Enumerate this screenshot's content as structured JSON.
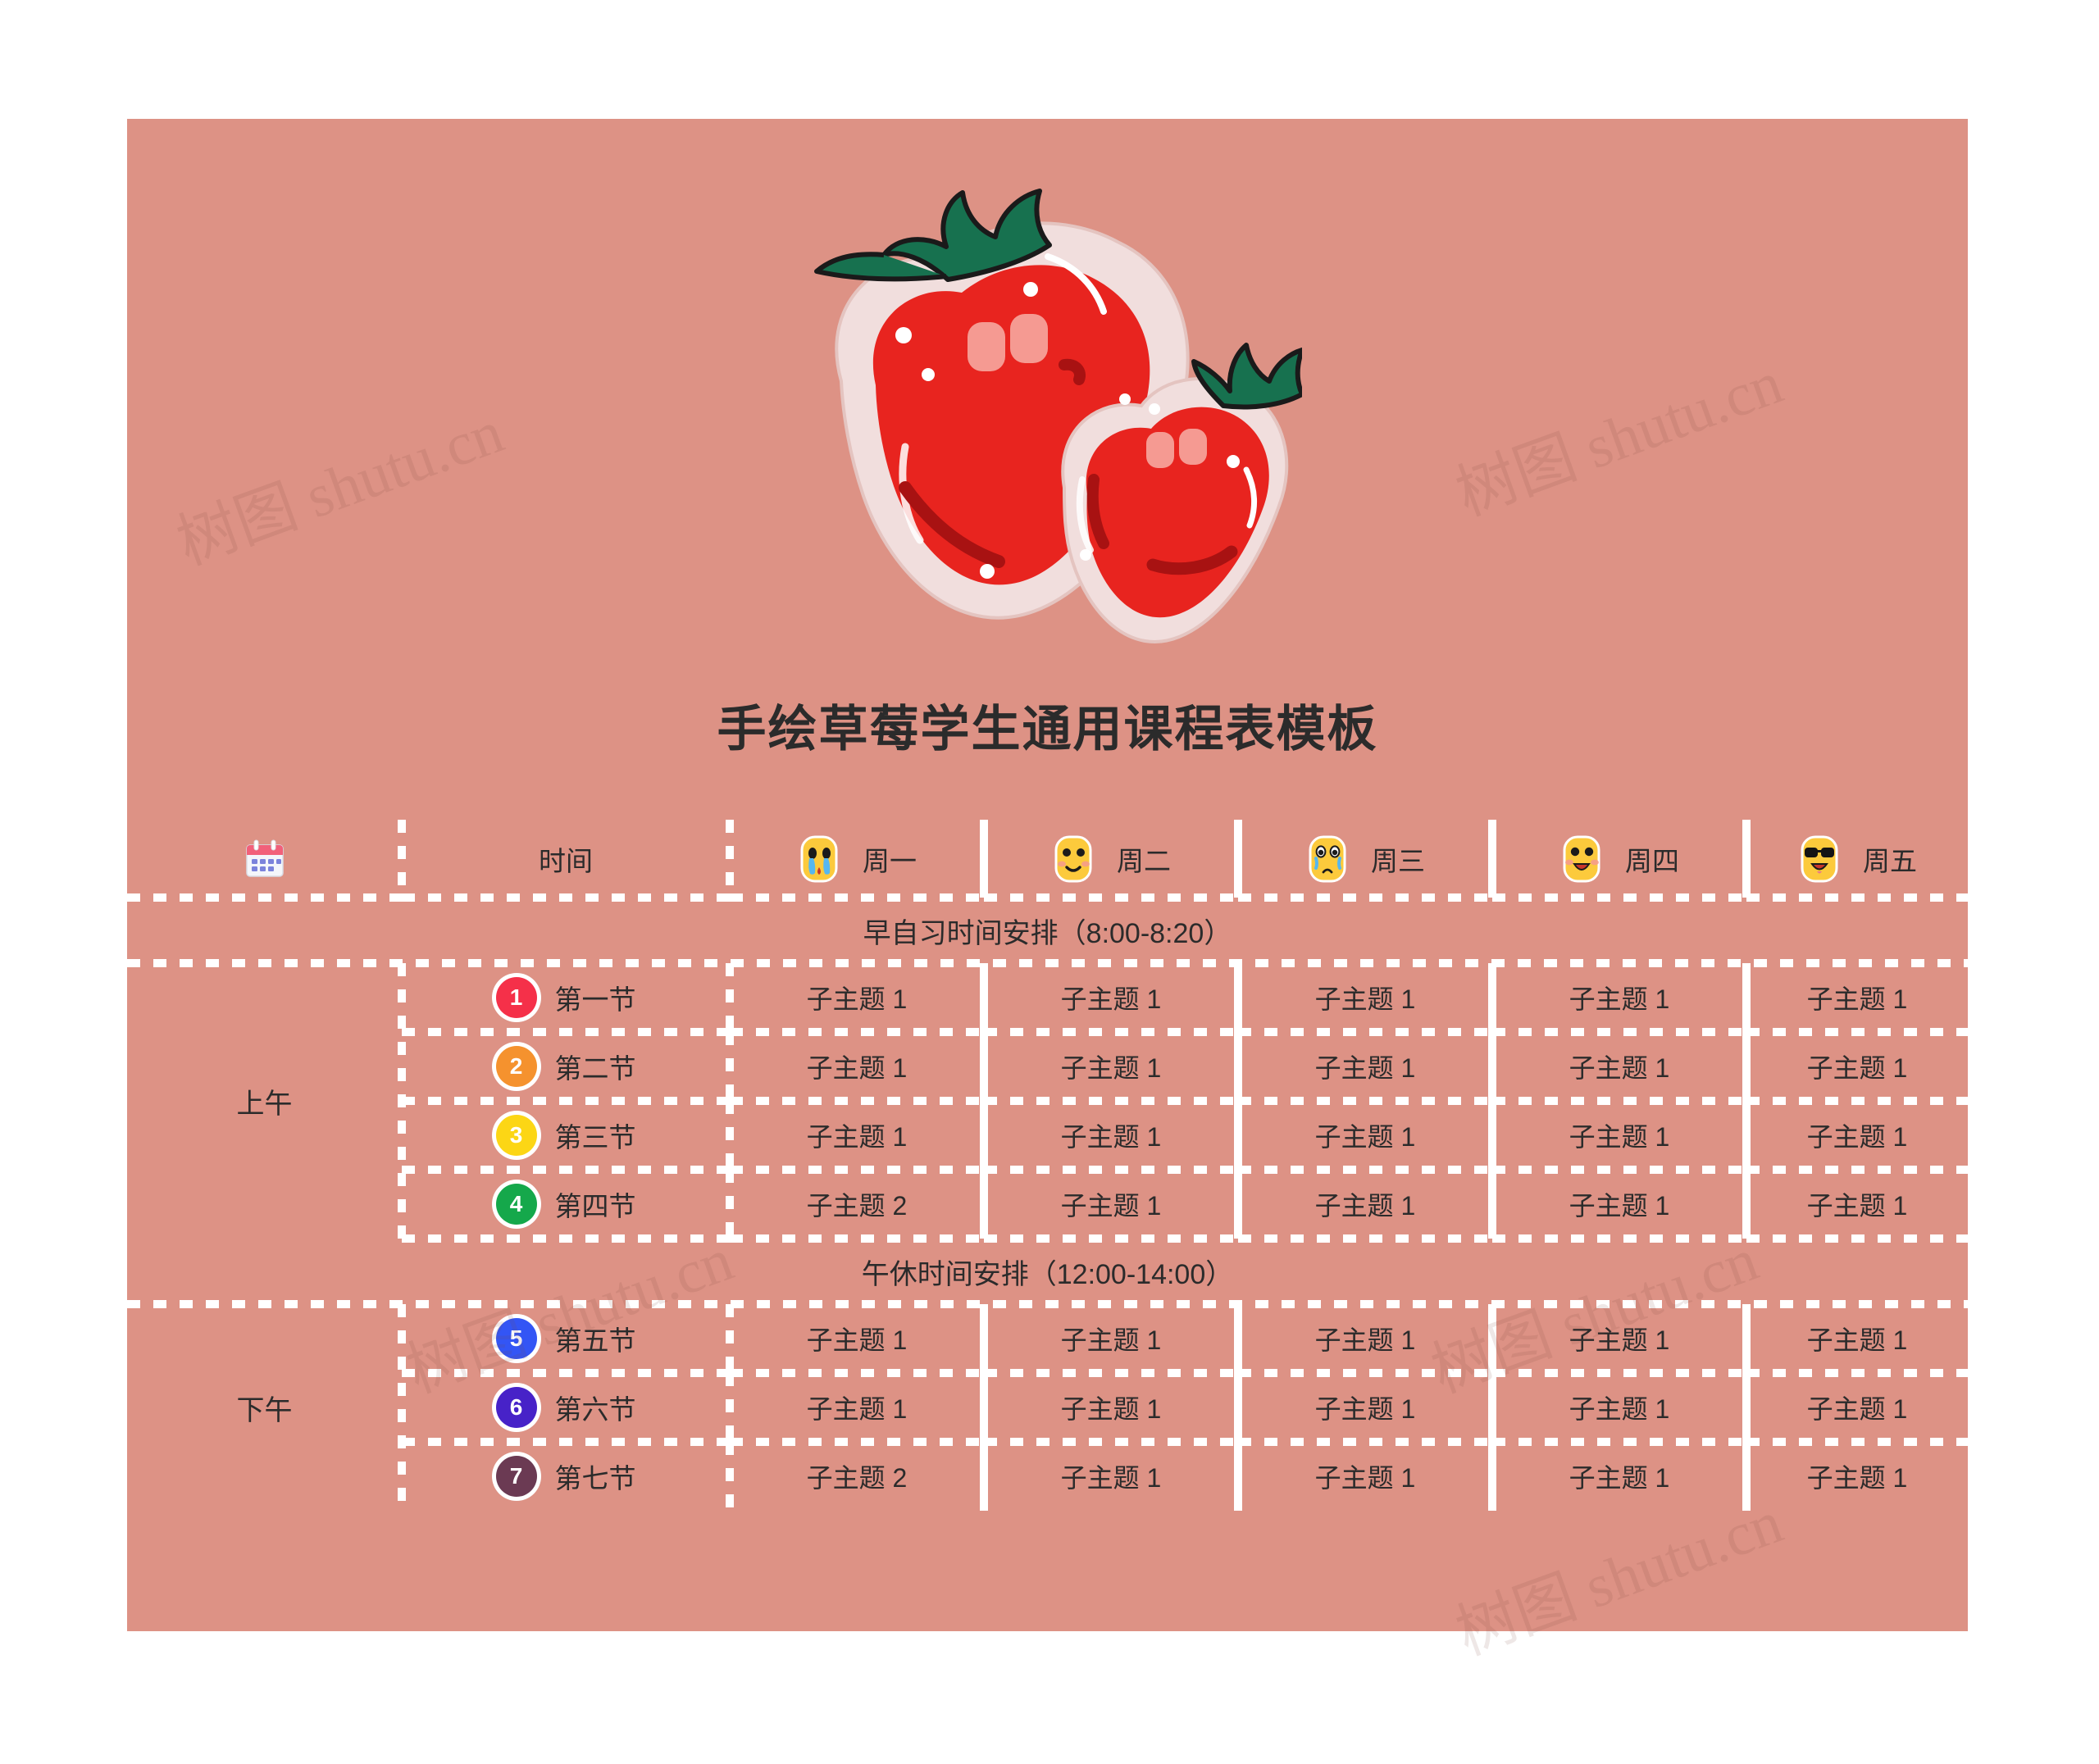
{
  "poster": {
    "title": "手绘草莓学生通用课程表模板",
    "background_color": "#DD9285",
    "border_color": "#FFFFFF",
    "illustration_name": "hand-drawn-strawberries"
  },
  "watermark": {
    "text": "树图 shutu.cn"
  },
  "table": {
    "header": {
      "corner_icon": "calendar-icon",
      "time_label": "时间",
      "days": [
        {
          "icon": "crying-face-emoji",
          "label": "周一"
        },
        {
          "icon": "smiling-face-emoji",
          "label": "周二"
        },
        {
          "icon": "sad-face-emoji",
          "label": "周三"
        },
        {
          "icon": "grinning-face-emoji",
          "label": "周四"
        },
        {
          "icon": "sunglasses-face-emoji",
          "label": "周五"
        }
      ]
    },
    "bands": {
      "morning_study": "早自习时间安排（8:00-8:20）",
      "noon_break": "午休时间安排（12:00-14:00）"
    },
    "halves": {
      "morning": "上午",
      "afternoon": "下午"
    },
    "rows": [
      {
        "num": "1",
        "color": "#F53049",
        "slot": "第一节",
        "cells": [
          "子主题 1",
          "子主题 1",
          "子主题 1",
          "子主题 1",
          "子主题 1"
        ]
      },
      {
        "num": "2",
        "color": "#F5922E",
        "slot": "第二节",
        "cells": [
          "子主题 1",
          "子主题 1",
          "子主题 1",
          "子主题 1",
          "子主题 1"
        ]
      },
      {
        "num": "3",
        "color": "#FCD615",
        "slot": "第三节",
        "cells": [
          "子主题 1",
          "子主题 1",
          "子主题 1",
          "子主题 1",
          "子主题 1"
        ]
      },
      {
        "num": "4",
        "color": "#15A84B",
        "slot": "第四节",
        "cells": [
          "子主题 2",
          "子主题 1",
          "子主题 1",
          "子主题 1",
          "子主题 1"
        ]
      },
      {
        "num": "5",
        "color": "#3355F5",
        "slot": "第五节",
        "cells": [
          "子主题 1",
          "子主题 1",
          "子主题 1",
          "子主题 1",
          "子主题 1"
        ]
      },
      {
        "num": "6",
        "color": "#4722C8",
        "slot": "第六节",
        "cells": [
          "子主题 1",
          "子主题 1",
          "子主题 1",
          "子主题 1",
          "子主题 1"
        ]
      },
      {
        "num": "7",
        "color": "#6B3A53",
        "slot": "第七节",
        "cells": [
          "子主题 2",
          "子主题 1",
          "子主题 1",
          "子主题 1",
          "子主题 1"
        ]
      }
    ]
  }
}
